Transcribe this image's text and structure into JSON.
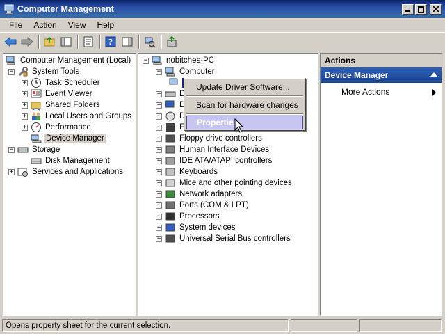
{
  "window": {
    "title": "Computer Management"
  },
  "menubar": {
    "items": [
      "File",
      "Action",
      "View",
      "Help"
    ]
  },
  "left_tree": {
    "root": "Computer Management (Local)",
    "system_tools": "System Tools",
    "task_scheduler": "Task Scheduler",
    "event_viewer": "Event Viewer",
    "shared_folders": "Shared Folders",
    "local_users": "Local Users and Groups",
    "performance": "Performance",
    "device_manager": "Device Manager",
    "storage": "Storage",
    "disk_management": "Disk Management",
    "services": "Services and Applications"
  },
  "device_tree": {
    "pc": "nobitches-PC",
    "computer": "Computer",
    "devices": [
      "Floppy drive controllers",
      "Human Interface Devices",
      "IDE ATA/ATAPI controllers",
      "Keyboards",
      "Mice and other pointing devices",
      "Network adapters",
      "Ports (COM & LPT)",
      "Processors",
      "System devices",
      "Universal Serial Bus controllers"
    ]
  },
  "context_menu": {
    "update_driver": "Update Driver Software...",
    "scan": "Scan for hardware changes",
    "properties": "Propertie"
  },
  "actions": {
    "header": "Actions",
    "group": "Device Manager",
    "more_actions": "More Actions"
  },
  "status": {
    "text": "Opens property sheet for the current selection."
  },
  "colors": {
    "titlebar": "#0a246a",
    "action_group": "#2b5fb4",
    "highlight": "#c6c6f0"
  }
}
